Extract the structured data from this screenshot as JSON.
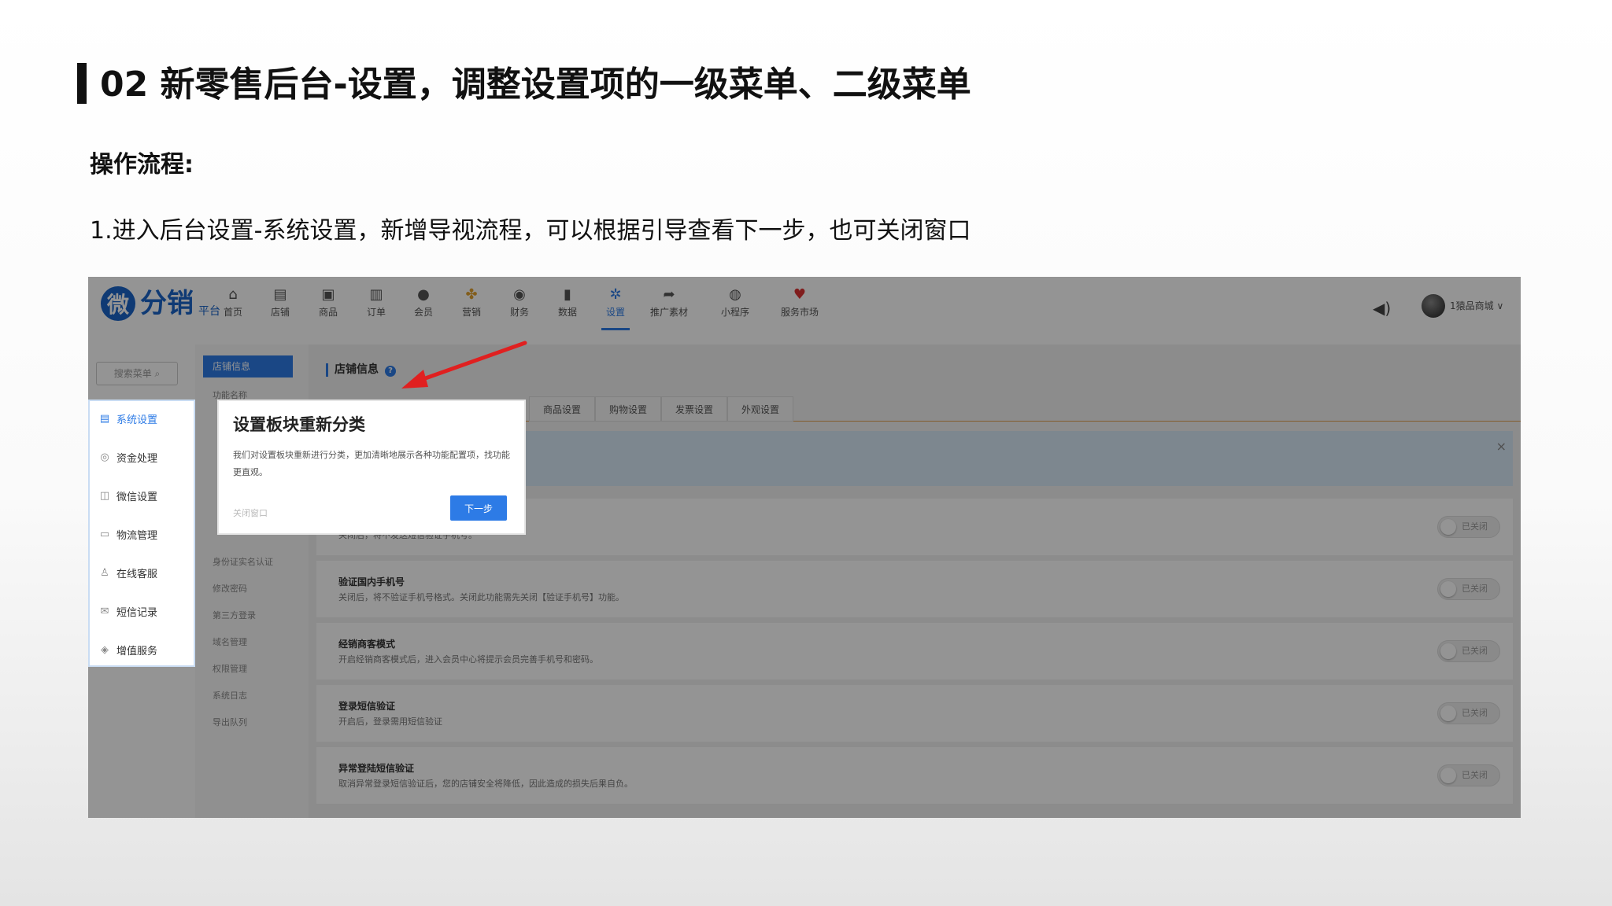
{
  "slide": {
    "title": "02 新零售后台-设置，调整设置项的一级菜单、二级菜单",
    "section_label": "操作流程:",
    "step_text": "1.进入后台设置-系统设置，新增导视流程，可以根据引导查看下一步，也可关闭窗口"
  },
  "app": {
    "logo_mark": "微",
    "logo_text": "分销",
    "logo_sub": "平台",
    "nav": [
      {
        "label": "首页",
        "icon": "home-icon",
        "glyph": "⌂"
      },
      {
        "label": "店铺",
        "icon": "store-icon",
        "glyph": "▤"
      },
      {
        "label": "商品",
        "icon": "goods-icon",
        "glyph": "▣"
      },
      {
        "label": "订单",
        "icon": "order-icon",
        "glyph": "▥"
      },
      {
        "label": "会员",
        "icon": "member-icon",
        "glyph": "●"
      },
      {
        "label": "营销",
        "icon": "marketing-icon",
        "glyph": "✤"
      },
      {
        "label": "财务",
        "icon": "finance-icon",
        "glyph": "◉"
      },
      {
        "label": "数据",
        "icon": "chart-icon",
        "glyph": "▮"
      },
      {
        "label": "设置",
        "icon": "gear-icon",
        "glyph": "✲"
      },
      {
        "label": "推广素材",
        "icon": "share-icon",
        "glyph": "➦"
      },
      {
        "label": "小程序",
        "icon": "miniapp-icon",
        "glyph": "◍"
      },
      {
        "label": "服务市场",
        "icon": "market-icon",
        "glyph": "♥"
      }
    ],
    "shop_name": "1猿品商城 ∨",
    "side_search": "搜索菜单 ⌕",
    "menu_level1": [
      {
        "label": "系统设置",
        "icon": "document-icon",
        "glyph": "▤"
      },
      {
        "label": "资金处理",
        "icon": "money-icon",
        "glyph": "◎"
      },
      {
        "label": "微信设置",
        "icon": "wechat-icon",
        "glyph": "◫"
      },
      {
        "label": "物流管理",
        "icon": "truck-icon",
        "glyph": "▭"
      },
      {
        "label": "在线客服",
        "icon": "user-icon",
        "glyph": "♙"
      },
      {
        "label": "短信记录",
        "icon": "mail-icon",
        "glyph": "✉"
      },
      {
        "label": "增值服务",
        "icon": "service-icon",
        "glyph": "◈"
      }
    ],
    "menu_level2_active": "店铺信息",
    "menu_level2": [
      "功能名称",
      "",
      "",
      "",
      "",
      "",
      "身份证实名认证",
      "修改密码",
      "第三方登录",
      "域名管理",
      "权限管理",
      "系统日志",
      "导出队列"
    ],
    "panel_title": "店铺信息",
    "tabs": [
      "商品设置",
      "购物设置",
      "发票设置",
      "外观设置"
    ],
    "settings": [
      {
        "title": "",
        "desc": "关闭后，将不发送短信验证手机号。",
        "toggle": "已关闭"
      },
      {
        "title": "验证国内手机号",
        "desc": "关闭后，将不验证手机号格式。关闭此功能需先关闭【验证手机号】功能。",
        "toggle": "已关闭"
      },
      {
        "title": "经销商客模式",
        "desc": "开启经销商客模式后，进入会员中心将提示会员完善手机号和密码。",
        "toggle": "已关闭"
      },
      {
        "title": "登录短信验证",
        "desc": "开启后，登录需用短信验证",
        "toggle": "已关闭"
      },
      {
        "title": "异常登陆短信验证",
        "desc": "取消异常登录短信验证后，您的店铺安全将降低，因此造成的损失后果自负。",
        "toggle": "已关闭"
      }
    ],
    "popup": {
      "title": "设置板块重新分类",
      "body": "我们对设置板块重新进行分类，更加清晰地展示各种功能配置项，找功能更直观。",
      "close_label": "关闭窗口",
      "next_label": "下一步"
    }
  }
}
